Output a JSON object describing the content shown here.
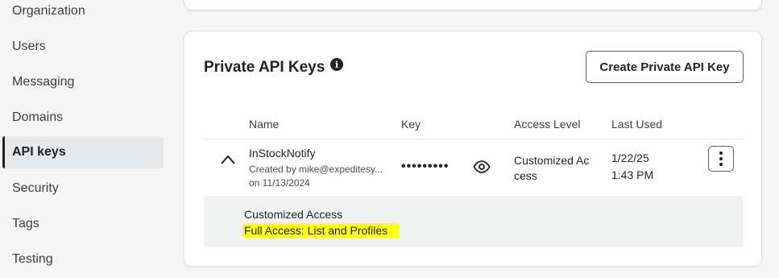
{
  "sidebar": {
    "items": [
      {
        "label": "Organization"
      },
      {
        "label": "Users"
      },
      {
        "label": "Messaging"
      },
      {
        "label": "Domains"
      },
      {
        "label": "API keys",
        "active": true
      },
      {
        "label": "Security"
      },
      {
        "label": "Tags"
      },
      {
        "label": "Testing"
      }
    ]
  },
  "private_keys": {
    "title": "Private API Keys",
    "info_icon": "i",
    "create_button": "Create Private API Key",
    "columns": [
      "Name",
      "Key",
      "Access Level",
      "Last Used"
    ],
    "rows": [
      {
        "name": "InStockNotify",
        "created_by": "Created by mike@expeditesy...",
        "created_on": "on 11/13/2024",
        "key_masked": "•••••••••",
        "access_level": "Customized Ac cess",
        "last_used_date": "1/22/25",
        "last_used_time": "1:43 PM",
        "expanded": {
          "title": "Customized Access",
          "scope": "Full Access: List and Profiles"
        }
      }
    ]
  },
  "colors": {
    "highlight": "#ffff1a",
    "text": "#1f2326",
    "panel_bg": "#f1f2f2"
  },
  "icons": {
    "expand": "chevron-up-icon",
    "reveal": "eye-icon",
    "menu": "kebab-menu-icon",
    "info": "info-icon"
  }
}
